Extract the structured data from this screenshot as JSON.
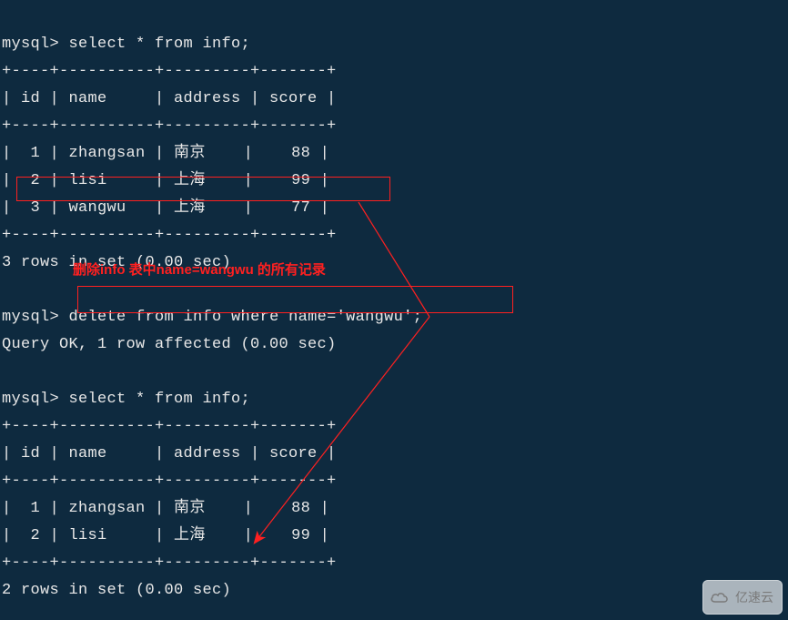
{
  "prompt": "mysql>",
  "query1": "select * from info;",
  "border_top": "+----+----------+---------+-------+",
  "header_line": "| id | name     | address | score |",
  "border_mid": "+----+----------+---------+-------+",
  "table1_rows": [
    "|  1 | zhangsan | 南京    |    88 |",
    "|  2 | lisi     | 上海    |    99 |",
    "|  3 | wangwu   | 上海    |    77 |"
  ],
  "border_bot": "+----+----------+---------+-------+",
  "result1": "3 rows in set (0.00 sec)",
  "annotation": "删除info 表中name=wangwu 的所有记录",
  "query2": "delete from info where name='wangwu';",
  "affected": "Query OK, 1 row affected (0.00 sec)",
  "query3": "select * from info;",
  "table2_rows": [
    "|  1 | zhangsan | 南京    |    88 |",
    "|  2 | lisi     | 上海    |    99 |"
  ],
  "result2": "2 rows in set (0.00 sec)",
  "watermark": "亿速云",
  "chart_data": {
    "type": "table",
    "title": "info",
    "columns": [
      "id",
      "name",
      "address",
      "score"
    ],
    "rows_before": [
      {
        "id": 1,
        "name": "zhangsan",
        "address": "南京",
        "score": 88
      },
      {
        "id": 2,
        "name": "lisi",
        "address": "上海",
        "score": 99
      },
      {
        "id": 3,
        "name": "wangwu",
        "address": "上海",
        "score": 77
      }
    ],
    "rows_after": [
      {
        "id": 1,
        "name": "zhangsan",
        "address": "南京",
        "score": 88
      },
      {
        "id": 2,
        "name": "lisi",
        "address": "上海",
        "score": 99
      }
    ],
    "delete_condition": "name='wangwu'"
  }
}
